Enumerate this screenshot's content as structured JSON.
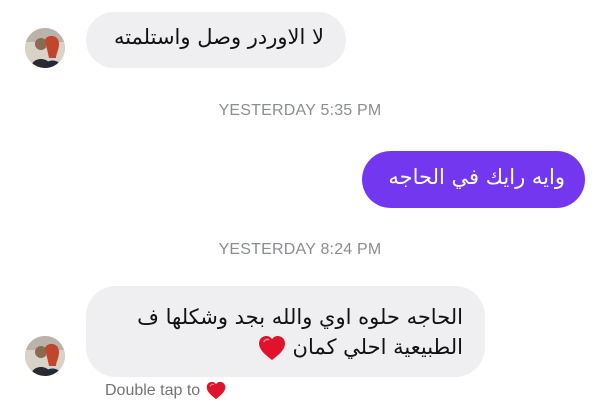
{
  "thread": {
    "messages": [
      {
        "direction": "incoming",
        "text": "لا الاوردر وصل واستلمته"
      },
      {
        "timestamp": "YESTERDAY 5:35 PM"
      },
      {
        "direction": "outgoing",
        "text": "وايه رايك في الحاجه"
      },
      {
        "timestamp": "YESTERDAY 8:24 PM"
      },
      {
        "direction": "incoming",
        "line1": "الحاجه حلوه اوي والله بجد وشكلها ف",
        "line2": "الطبيعية احلي كمان",
        "emoji": "red-heart"
      }
    ],
    "reaction_hint": "Double tap to",
    "reaction_icon": "red-heart-icon"
  },
  "colors": {
    "incoming_bubble": "#efeff1",
    "outgoing_bubble": "#7337f0",
    "timestamp_text": "#8a8d91",
    "heart": "#e0132c"
  }
}
